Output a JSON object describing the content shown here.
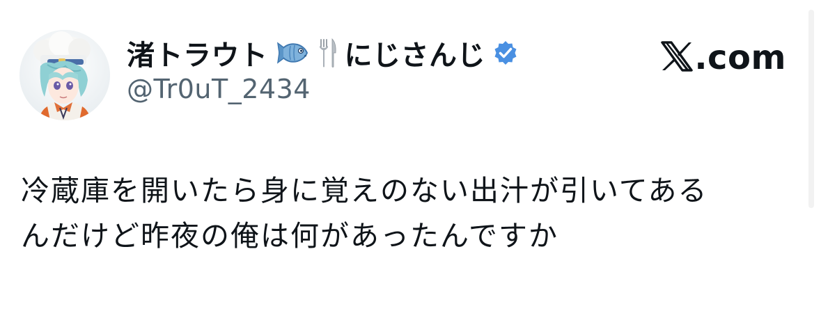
{
  "author": {
    "display_name": "渚トラウト",
    "display_name_suffix": "にじさんじ",
    "handle": "@Tr0uT_2434",
    "name_icons": [
      "fish-icon",
      "fork-and-knife-icon"
    ],
    "verified": true,
    "verified_color": "#4a90e2"
  },
  "brand": {
    "text": ".com",
    "logo": "x-logo"
  },
  "tweet": {
    "lines": [
      "冷蔵庫を開いたら身に覚えのない出汁が引いてある",
      "んだけど昨夜の俺は何があったんですか"
    ]
  },
  "colors": {
    "text_primary": "#0f1419",
    "text_secondary": "#536471",
    "background": "#ffffff"
  }
}
